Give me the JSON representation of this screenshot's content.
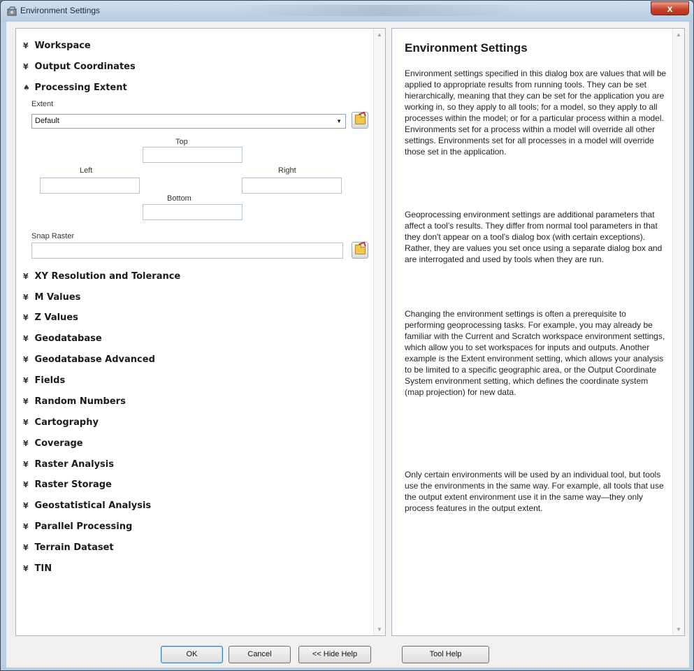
{
  "window": {
    "title": "Environment Settings",
    "close_glyph": "x"
  },
  "sections_top": [
    {
      "label": "Workspace",
      "chevron": "¥"
    },
    {
      "label": "Output Coordinates",
      "chevron": "¥"
    },
    {
      "label": "Processing Extent",
      "chevron": "♠"
    }
  ],
  "extent": {
    "label": "Extent",
    "combo_value": "Default",
    "top_label": "Top",
    "left_label": "Left",
    "right_label": "Right",
    "bottom_label": "Bottom",
    "snap_label": "Snap Raster"
  },
  "sections_bottom": [
    {
      "label": "XY Resolution and Tolerance",
      "chevron": "¥"
    },
    {
      "label": "M Values",
      "chevron": "¥"
    },
    {
      "label": "Z Values",
      "chevron": "¥"
    },
    {
      "label": "Geodatabase",
      "chevron": "¥"
    },
    {
      "label": "Geodatabase Advanced",
      "chevron": "¥"
    },
    {
      "label": "Fields",
      "chevron": "¥"
    },
    {
      "label": "Random Numbers",
      "chevron": "¥"
    },
    {
      "label": "Cartography",
      "chevron": "¥"
    },
    {
      "label": "Coverage",
      "chevron": "¥"
    },
    {
      "label": "Raster Analysis",
      "chevron": "¥"
    },
    {
      "label": "Raster Storage",
      "chevron": "¥"
    },
    {
      "label": "Geostatistical Analysis",
      "chevron": "¥"
    },
    {
      "label": "Parallel Processing",
      "chevron": "¥"
    },
    {
      "label": "Terrain Dataset",
      "chevron": "¥"
    },
    {
      "label": "TIN",
      "chevron": "¥"
    }
  ],
  "help": {
    "title": "Environment Settings",
    "p1": "Environment settings specified in this dialog box are values that will be applied to appropriate results from running tools. They can be set hierarchically, meaning that they can be set for the application you are working in, so they apply to all tools; for a model, so they apply to all processes within the model; or for a particular process within a model. Environments set for a process within a model will override all other settings. Environments set for all processes in a model will override those set in the application.",
    "p2": "Geoprocessing environment settings are additional parameters that affect a tool's results. They differ from normal tool parameters in that they don't appear on a tool's dialog box (with certain exceptions). Rather, they are values you set once using a separate dialog box and are interrogated and used by tools when they are run.",
    "p3": "Changing the environment settings is often a prerequisite to performing geoprocessing tasks. For example, you may already be familiar with the Current and Scratch workspace environment settings, which allow you to set workspaces for inputs and outputs. Another example is the Extent environment setting, which allows your analysis to be limited to a specific geographic area, or the Output Coordinate System environment setting, which defines the coordinate system (map projection) for new data.",
    "p4": "Only certain environments will be used by an individual tool, but tools use the environments in the same way. For example, all tools that use the output extent environment use it in the same way—they only process features in the output extent."
  },
  "buttons": {
    "ok": "OK",
    "cancel": "Cancel",
    "hide_help": "<< Hide Help",
    "tool_help": "Tool Help"
  }
}
